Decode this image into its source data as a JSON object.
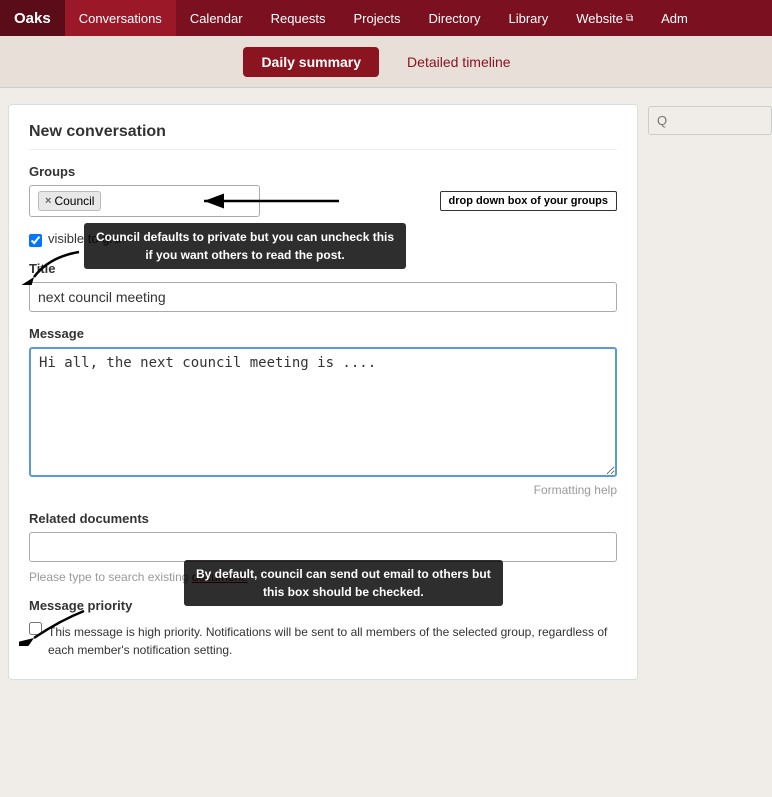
{
  "brand": {
    "name": "Oaks"
  },
  "nav": {
    "items": [
      {
        "label": "Conversations",
        "active": true
      },
      {
        "label": "Calendar",
        "active": false
      },
      {
        "label": "Requests",
        "active": false
      },
      {
        "label": "Projects",
        "active": false
      },
      {
        "label": "Directory",
        "active": false
      },
      {
        "label": "Library",
        "active": false
      },
      {
        "label": "Website",
        "active": false,
        "ext": true
      },
      {
        "label": "Adm",
        "active": false
      }
    ]
  },
  "subnav": {
    "daily_summary": "Daily summary",
    "detailed_timeline": "Detailed timeline"
  },
  "form": {
    "title": "New conversation",
    "groups_label": "Groups",
    "groups_tag": "Council",
    "groups_annotation": "drop down box of your groups",
    "visibility_label": "visible to gro",
    "visibility_annotation_line1": "Council defaults to private but you can uncheck this",
    "visibility_annotation_line2": "if you want others to read the post.",
    "title_label": "Title",
    "title_value": "next council meeting",
    "message_label": "Message",
    "message_value": "Hi all, the next council meeting is ....",
    "formatting_help": "Formatting help",
    "related_docs_label": "Related documents",
    "related_docs_placeholder": "",
    "related_help_text": "Please type to search existing",
    "related_help_link": "document.",
    "related_annotation_line1": "By default, council can send out email to others but",
    "related_annotation_line2": "this box should be checked.",
    "priority_label": "Message priority",
    "priority_desc": "This message is high priority. Notifications will be sent to all members of the selected group, regardless of each member's notification setting."
  },
  "sidebar": {
    "search_placeholder": "Q"
  }
}
